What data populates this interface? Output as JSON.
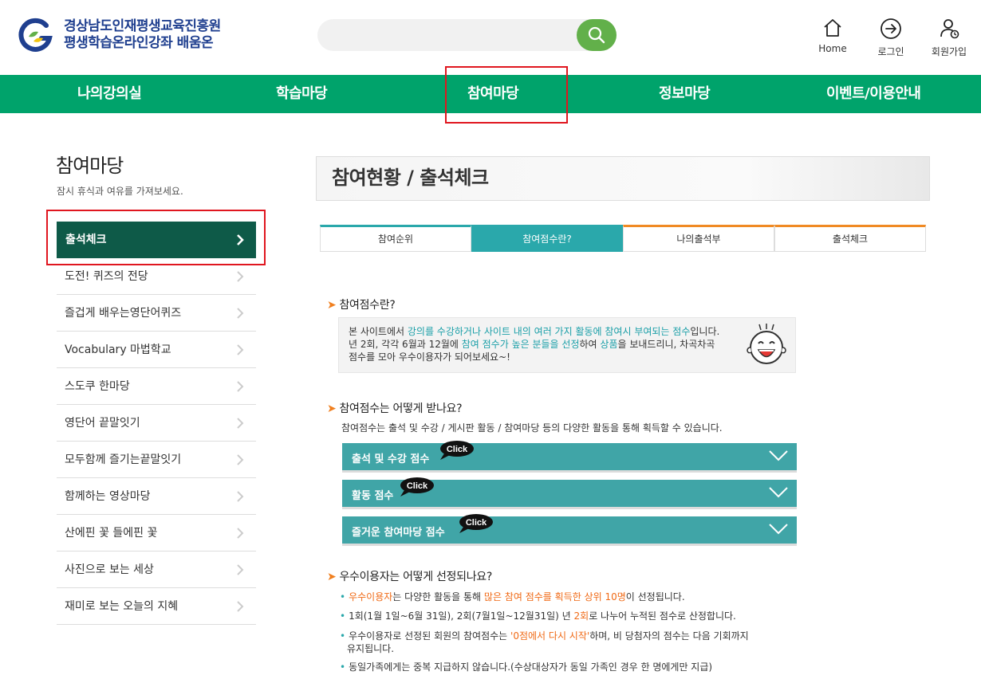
{
  "header": {
    "logo_line1": "경상남도인재평생교육진흥원",
    "logo_line2": "평생학습온라인강좌 배움온",
    "search_placeholder": "",
    "utils": [
      {
        "label": "Home",
        "icon": "home-icon"
      },
      {
        "label": "로그인",
        "icon": "login-icon"
      },
      {
        "label": "회원가입",
        "icon": "user-add-icon"
      }
    ]
  },
  "gnb": {
    "items": [
      "나의강의실",
      "학습마당",
      "참여마당",
      "정보마당",
      "이벤트/이용안내"
    ]
  },
  "side": {
    "title": "참여마당",
    "subtitle": "잠시 휴식과 여유를 가져보세요.",
    "active": "출석체크",
    "items": [
      "도전! 퀴즈의 전당",
      "즐겁게 배우는영단어퀴즈",
      "Vocabulary 마법학교",
      "스도쿠 한마당",
      "영단어 끝말잇기",
      "모두함께 즐기는끝말잇기",
      "함께하는 영상마당",
      "산에핀 꽃 들에핀 꽃",
      "사진으로 보는 세상",
      "재미로 보는 오늘의 지혜"
    ]
  },
  "content": {
    "page_title": "참여현황 / 출석체크",
    "tabs": [
      "참여순위",
      "참여점수란?",
      "나의출석부",
      "출석체크"
    ],
    "s1_title": "참여점수란?",
    "intro": {
      "l1a": "본 사이트에서 ",
      "l1b": "강의를 수강하거나 사이트 내의 여러 가지 활동에 참여시 부여되는 점수",
      "l1c": "입니다.",
      "l2a": "년 2회, 각각 6월과 12월에 ",
      "l2b": "참여 점수가 높은 분들을 선정",
      "l2c": "하여 ",
      "l2d": "상품",
      "l2e": "을 보내드리니, 차곡차곡",
      "l3": "점수를 모아 우수이용자가 되어보세요~!"
    },
    "s2_title": "참여점수는 어떻게 받나요?",
    "s2_desc": "참여점수는 출석 및 수강 / 게시판 활동 / 참여마당 등의 다양한 활동을 통해 획득할 수 있습니다.",
    "accordions": [
      "출석 및 수강 점수",
      "활동 점수",
      "즐거운 참여마당 점수"
    ],
    "click_label": "Click",
    "s3_title": "우수이용자는 어떻게 선정되나요?",
    "b1a": "우수이용자",
    "b1b": "는 다양한 활동을 통해 ",
    "b1c": "많은 참여 점수를 획득한 상위 10명",
    "b1d": "이 선정됩니다.",
    "b2a": "1회(1월 1일~6월 31일), 2회(7월1일~12월31일) 년 ",
    "b2b": "2회",
    "b2c": "로 나누어 누적된 점수로 산정합니다.",
    "b3a": "우수이용자로 선정된 회원의 참여점수는 ",
    "b3b": "'0점에서 다시 시작'",
    "b3c": "하며, 비 당첨자의 점수는 다음 기회까지",
    "b3d": "유지됩니다.",
    "b4": "동일가족에게는 중복 지급하지 않습니다.(수상대상자가 동일 가족인 경우 한 명에게만 지급)"
  },
  "colors": {
    "gnb": "#00a36b",
    "active_side": "#0e5a48",
    "teal": "#2aa8ab",
    "highlight": "#e0161f",
    "orange": "#f07f1f"
  }
}
